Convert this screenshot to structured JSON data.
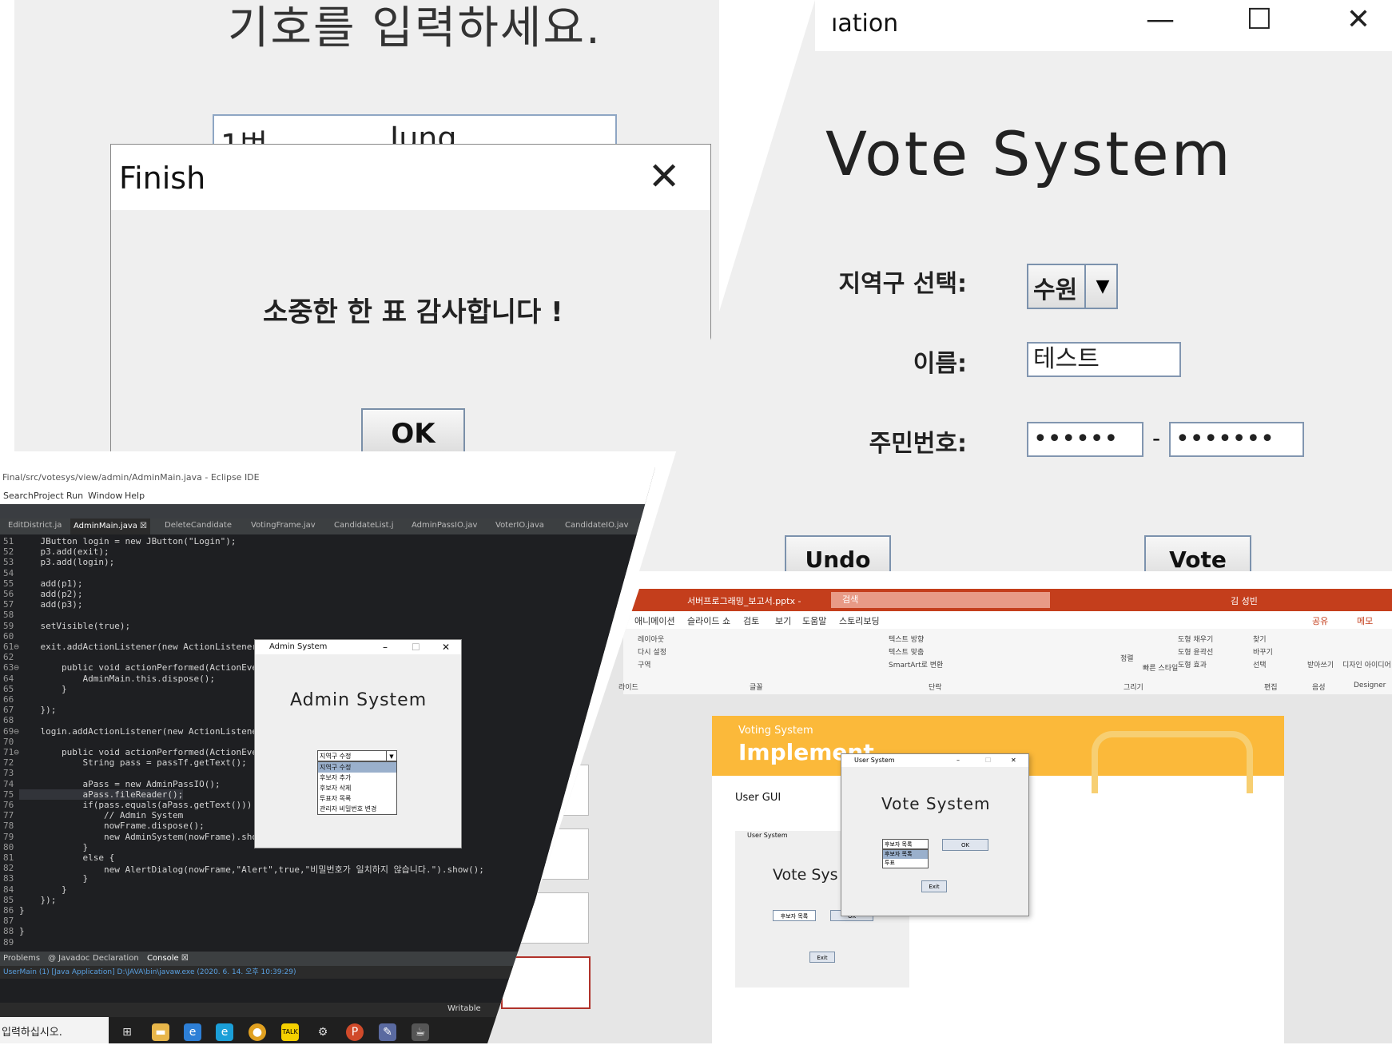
{
  "finish_panel": {
    "prompt": "기호를 입력하세요.",
    "ballot_number": "1번",
    "ballot_name": "Jung",
    "dialog_title": "Finish",
    "close_glyph": "✕",
    "message": "소중한 한 표 감사합니다 !",
    "ok_label": "OK"
  },
  "vote_panel": {
    "window_title": "ıation",
    "minimize_glyph": "—",
    "maximize_glyph": "☐",
    "close_glyph": "✕",
    "heading": "Vote System",
    "district_label": "지역구 선택:",
    "district_value": "수원",
    "district_arrow": "▼",
    "name_label": "이름:",
    "name_value": "테스트",
    "rrn_label": "주민번호:",
    "rrn_front": "••••••",
    "rrn_dash": "-",
    "rrn_back": "•••••••",
    "undo_label": "Undo",
    "vote_label": "Vote"
  },
  "eclipse": {
    "title": "Final/src/votesys/view/admin/AdminMain.java - Eclipse IDE",
    "menu": [
      "Search",
      "Project",
      "Run",
      "Window",
      "Help"
    ],
    "tabs": [
      "EditDistrict.ja",
      "AdminMain.java ☒",
      "DeleteCandidate",
      "VotingFrame.jav",
      "CandidateList.j",
      "AdminPassIO.jav",
      "VoterIO.java",
      "CandidateIO.jav"
    ],
    "active_tab": 1,
    "line_numbers": [
      "51",
      "52",
      "53",
      "54",
      "55",
      "56",
      "57",
      "58",
      "59",
      "60",
      "61⊖",
      "62",
      "63⊖",
      "64",
      "65",
      "66",
      "67",
      "68",
      "69⊖",
      "70",
      "71⊖",
      "72",
      "73",
      "74",
      "75",
      "76",
      "77",
      "78",
      "79",
      "80",
      "81",
      "82",
      "83",
      "84",
      "85",
      "86",
      "87",
      "88",
      "89"
    ],
    "code_lines": [
      "    JButton login = new JButton(\"Login\");",
      "    p3.add(exit);",
      "    p3.add(login);",
      "",
      "    add(p1);",
      "    add(p2);",
      "    add(p3);",
      "",
      "    setVisible(true);",
      "",
      "    exit.addActionListener(new ActionListener",
      "",
      "        public void actionPerformed(ActionEve",
      "            AdminMain.this.dispose();",
      "        }",
      "",
      "    });",
      "",
      "    login.addActionListener(new ActionListene",
      "",
      "        public void actionPerformed(ActionEve",
      "            String pass = passTf.getText();",
      "",
      "            aPass = new AdminPassIO();",
      "            aPass.fileReader();",
      "            if(pass.equals(aPass.getText()))",
      "                // Admin System",
      "                nowFrame.dispose();",
      "                new AdminSystem(nowFrame).sho",
      "            }",
      "            else {",
      "                new AlertDialog(nowFrame,\"Alert\",true,\"비밀번호가 일치하지 않습니다.\").show();",
      "            }",
      "        }",
      "    });",
      "}",
      "",
      "}",
      ""
    ],
    "console_tabs": [
      "Problems",
      "@ Javadoc",
      "Declaration",
      "Console ☒"
    ],
    "console_line": "UserMain (1) [Java Application] D:\\JAVA\\bin\\javaw.exe  (2020. 6. 14. 오후 10:39:29)",
    "status": "Writable",
    "taskbar_search": "입력하십시오."
  },
  "admin_popup": {
    "title": "Admin System",
    "heading": "Admin System",
    "dropdown_value": "지역구 수정",
    "options": [
      "지역구 수정",
      "후보자 추가",
      "후보자 삭제",
      "투표자 목록",
      "관리자 비밀번호 변경"
    ],
    "selected_index": 0
  },
  "powerpoint": {
    "filename": "서버프로그래밍_보고서.pptx -",
    "search_placeholder": "검색",
    "user": "김 성빈",
    "share": "공유",
    "memo": "메모",
    "tabs": [
      "애니메이션",
      "슬라이드 쇼",
      "검토",
      "보기",
      "도움말",
      "스토리보딩"
    ],
    "groups": [
      "라이드",
      "글꼴",
      "단락",
      "그리기",
      "편집",
      "음성",
      "Designer"
    ],
    "ribbon_items": [
      "레이아웃",
      "다시 설정",
      "구역",
      "텍스트 방향",
      "텍스트 맞춤",
      "SmartArt로 변환",
      "정렬",
      "빠른 스타일",
      "도형 채우기",
      "도형 윤곽선",
      "도형 효과",
      "찾기",
      "바꾸기",
      "선택",
      "받아쓰기",
      "디자인 아이디어"
    ],
    "slide_subtitle": "Voting System",
    "slide_title": "Implement",
    "user_gui_label": "User GUI",
    "user_window_title": "User System",
    "user_window_heading": "Vote Sys",
    "user_window_dropdown": "후보자 목록",
    "user_window_ok": "OK",
    "user_window_exit": "Exit",
    "vote_window_title": "User System",
    "vote_window_heading": "Vote System",
    "vote_window_dropdown": "후보자 목록",
    "vote_window_options": [
      "후보자 목록",
      "투표"
    ],
    "vote_window_ok": "OK",
    "vote_window_exit": "Exit"
  }
}
